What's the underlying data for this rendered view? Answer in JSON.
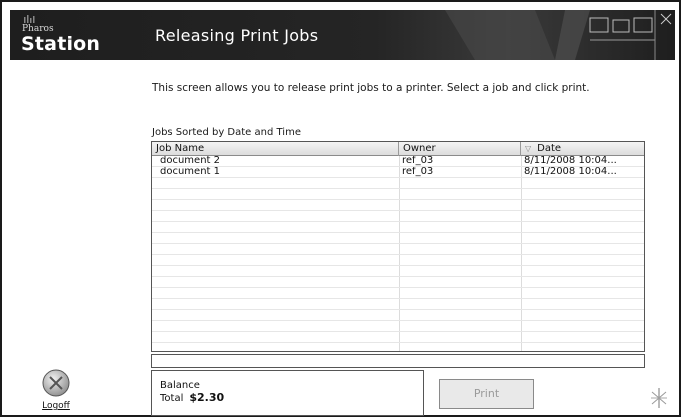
{
  "app": {
    "logo_small": "Pharos",
    "logo_big": "Station",
    "title": "Releasing Print Jobs"
  },
  "intro_text": "This screen allows you to release print jobs to a printer. Select a job and click print.",
  "table": {
    "caption": "Jobs Sorted by Date and Time",
    "columns": [
      "Job Name",
      "Owner",
      "Date"
    ],
    "sort_column": "Date",
    "rows": [
      {
        "name": "document 2",
        "owner": "ref_03",
        "date": "8/11/2008 10:04..."
      },
      {
        "name": "document 1",
        "owner": "ref_03",
        "date": "8/11/2008 10:04..."
      }
    ]
  },
  "balance": {
    "label": "Balance",
    "total_label": "Total",
    "total_value": "$2.30"
  },
  "buttons": {
    "print": "Print",
    "logoff": "Logoff"
  },
  "colors": {
    "header_bg": "#1e1e1e",
    "header_text": "#ffffff",
    "disabled_button_text": "#9a9a9a"
  }
}
